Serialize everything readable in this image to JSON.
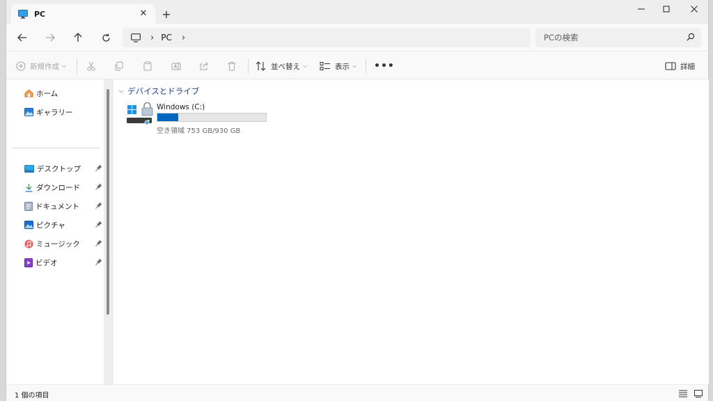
{
  "tab": {
    "title": "PC"
  },
  "address": {
    "crumbs": [
      "PC"
    ]
  },
  "search": {
    "placeholder": "PCの検索"
  },
  "commands": {
    "new": "新規作成",
    "sort": "並べ替え",
    "view": "表示",
    "more": "•••",
    "details": "詳細"
  },
  "sidebar": {
    "items": [
      {
        "label": "ホーム"
      },
      {
        "label": "ギャラリー"
      },
      {
        "label": "デスクトップ"
      },
      {
        "label": "ダウンロード"
      },
      {
        "label": "ドキュメント"
      },
      {
        "label": "ピクチャ"
      },
      {
        "label": "ミュージック"
      },
      {
        "label": "ビデオ"
      }
    ]
  },
  "main": {
    "group": "デバイスとドライブ",
    "drives": [
      {
        "name": "Windows (C:)",
        "info": "空き領域 753 GB/930 GB",
        "used_fraction": 0.19
      }
    ]
  },
  "status": {
    "text": "1 個の項目"
  },
  "colors": {
    "accent": "#0067c0",
    "group_header": "#1f3a8a"
  }
}
